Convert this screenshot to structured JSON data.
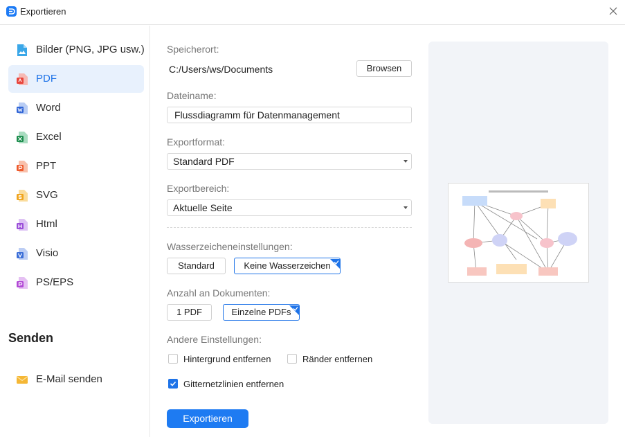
{
  "window": {
    "title": "Exportieren"
  },
  "sidebar": {
    "items": [
      {
        "label": "Bilder (PNG, JPG usw.)",
        "icon": "image-file-icon",
        "color": "#3aa7e8",
        "active": false
      },
      {
        "label": "PDF",
        "icon": "pdf-file-icon",
        "color": "#e8453c",
        "active": true
      },
      {
        "label": "Word",
        "icon": "word-file-icon",
        "color": "#2f64d6",
        "active": false
      },
      {
        "label": "Excel",
        "icon": "excel-file-icon",
        "color": "#1e8e4f",
        "active": false
      },
      {
        "label": "PPT",
        "icon": "ppt-file-icon",
        "color": "#ee5a2c",
        "active": false
      },
      {
        "label": "SVG",
        "icon": "svg-file-icon",
        "color": "#f0a51e",
        "active": false
      },
      {
        "label": "Html",
        "icon": "html-file-icon",
        "color": "#9b4fd9",
        "active": false
      },
      {
        "label": "Visio",
        "icon": "visio-file-icon",
        "color": "#3c6fd8",
        "active": false
      },
      {
        "label": "PS/EPS",
        "icon": "eps-file-icon",
        "color": "#b24ad6",
        "active": false
      }
    ],
    "send_section_title": "Senden",
    "send_items": [
      {
        "label": "E-Mail senden",
        "icon": "envelope-icon",
        "color": "#f5b735"
      }
    ]
  },
  "form": {
    "location_label": "Speicherort:",
    "location_value": "C:/Users/ws/Documents",
    "browse_label": "Browsen",
    "filename_label": "Dateiname:",
    "filename_value": "Flussdiagramm für Datenmanagement",
    "format_label": "Exportformat:",
    "format_value": "Standard PDF",
    "range_label": "Exportbereich:",
    "range_value": "Aktuelle Seite",
    "watermark_label": "Wasserzeicheneinstellungen:",
    "watermark_options": [
      "Standard",
      "Keine Wasserzeichen"
    ],
    "watermark_selected": "Keine Wasserzeichen",
    "documents_label": "Anzahl an Dokumenten:",
    "documents_options": [
      "1 PDF",
      "Einzelne PDFs"
    ],
    "documents_selected": "Einzelne PDFs",
    "other_label": "Andere Einstellungen:",
    "checkboxes": [
      {
        "label": "Hintergrund entfernen",
        "checked": false
      },
      {
        "label": "Ränder entfernen",
        "checked": false
      },
      {
        "label": "Gitternetzlinien entfernen",
        "checked": true
      }
    ],
    "export_button": "Exportieren"
  },
  "theme": {
    "accent": "#1e7bf2",
    "active_bg": "#e8f1fd"
  }
}
